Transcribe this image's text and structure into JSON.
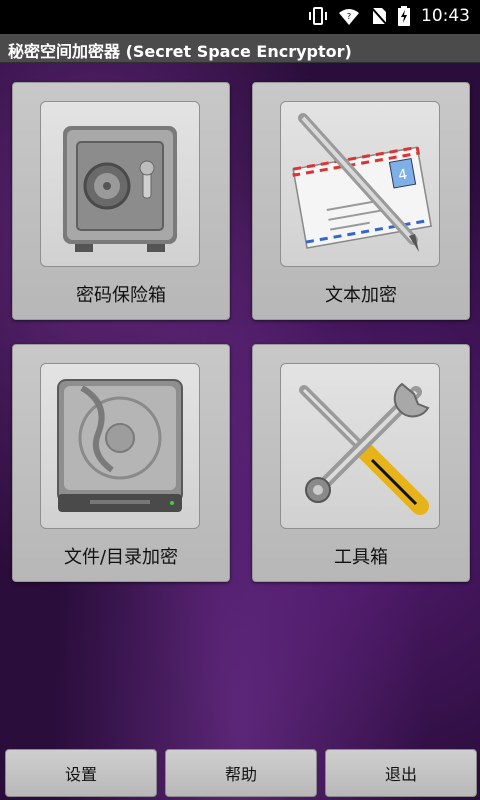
{
  "status_bar": {
    "time": "10:43",
    "icons": [
      "vibrate-icon",
      "wifi-icon",
      "no-sim-icon",
      "battery-charging-icon"
    ]
  },
  "title_bar": {
    "title": "秘密空间加密器 (Secret Space Encryptor)"
  },
  "tiles": [
    {
      "label": "密码保险箱",
      "icon": "safe-icon"
    },
    {
      "label": "文本加密",
      "icon": "envelope-pen-icon"
    },
    {
      "label": "文件/目录加密",
      "icon": "hard-drive-icon"
    },
    {
      "label": "工具箱",
      "icon": "tools-icon"
    }
  ],
  "bottom_bar": {
    "settings_label": "设置",
    "help_label": "帮助",
    "exit_label": "退出"
  }
}
